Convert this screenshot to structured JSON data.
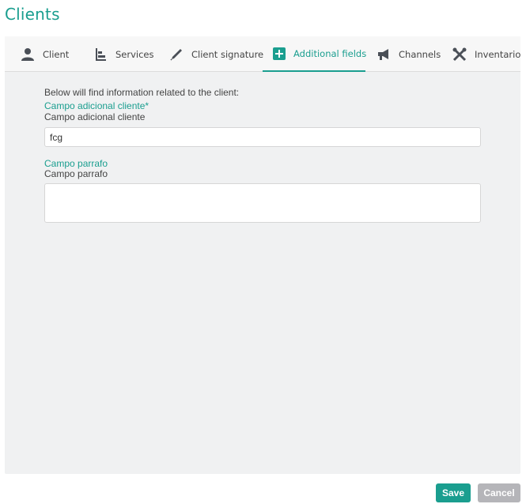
{
  "page": {
    "title": "Clients"
  },
  "tabs": [
    {
      "label": "Client",
      "icon": "user-icon"
    },
    {
      "label": "Services",
      "icon": "services-icon"
    },
    {
      "label": "Client signature",
      "icon": "pen-icon"
    },
    {
      "label": "Additional fields",
      "icon": "plus-box-icon",
      "active": true
    },
    {
      "label": "Channels",
      "icon": "megaphone-icon"
    },
    {
      "label": "Inventario",
      "icon": "tools-icon"
    }
  ],
  "form": {
    "intro": "Below will find information related to the client:",
    "fields": [
      {
        "title": "Campo adicional cliente*",
        "description": "Campo adicional cliente",
        "value": "fcg"
      },
      {
        "title": "Campo parrafo",
        "description": "Campo parrafo",
        "value": ""
      }
    ]
  },
  "actions": {
    "save": "Save",
    "cancel": "Cancel"
  },
  "colors": {
    "accent": "#1a9e8f",
    "cancel": "#b5b5b9",
    "panel": "#f0f1f2"
  }
}
